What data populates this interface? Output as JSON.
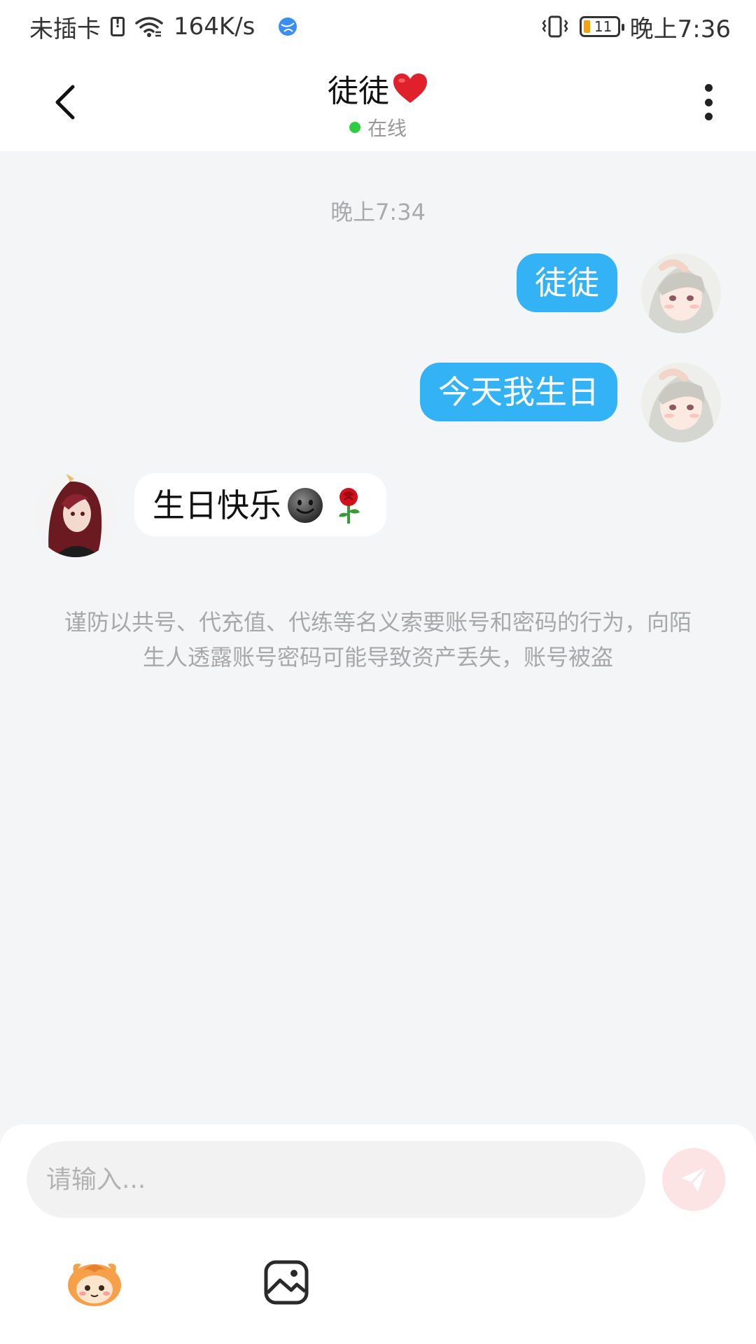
{
  "status_bar": {
    "carrier": "未插卡",
    "net_speed": "164K/s",
    "battery_level": "11",
    "time": "晚上7:36"
  },
  "header": {
    "title": "徒徒",
    "title_icon": "heart-icon",
    "status": "在线",
    "status_color": "#2ecc40"
  },
  "chat": {
    "timestamp": "晚上7:34",
    "messages": [
      {
        "side": "right",
        "text": "徒徒"
      },
      {
        "side": "right",
        "text": "今天我生日"
      },
      {
        "side": "left",
        "text": "生日快乐",
        "emojis": [
          "smiling-face-icon",
          "rose-icon"
        ]
      }
    ],
    "notice": "谨防以共号、代充值、代练等名义索要账号和密码的行为，向陌生人透露账号密码可能导致资产丢失，账号被盗"
  },
  "input": {
    "placeholder": "请输入..."
  },
  "colors": {
    "bubble_right": "#33b3f5",
    "bubble_left": "#ffffff",
    "send_button": "#fde4e4",
    "background": "#f4f5f7"
  }
}
